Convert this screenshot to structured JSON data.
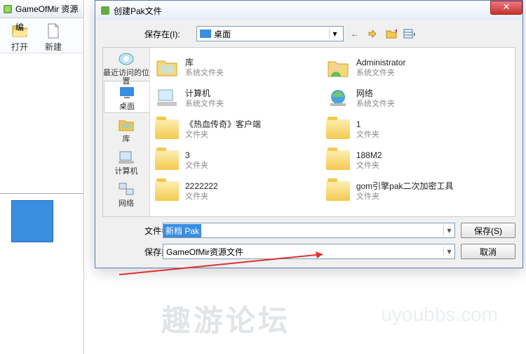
{
  "app": {
    "title": "GameOfMir 资源编"
  },
  "toolbar": {
    "open": "打开",
    "new": "新建"
  },
  "dialog": {
    "title": "创建Pak文件",
    "close": "✕",
    "save_in_label": "保存在(I):",
    "save_in_value": "桌面",
    "sidebar": [
      {
        "label": "最近访问的位置"
      },
      {
        "label": "桌面"
      },
      {
        "label": "库"
      },
      {
        "label": "计算机"
      },
      {
        "label": "网络"
      }
    ],
    "files": [
      [
        {
          "name": "库",
          "type": "系统文件夹"
        },
        {
          "name": "Administrator",
          "type": "系统文件夹"
        }
      ],
      [
        {
          "name": "计算机",
          "type": "系统文件夹"
        },
        {
          "name": "网络",
          "type": "系统文件夹"
        }
      ],
      [
        {
          "name": "《热血传奇》客户端",
          "type": "文件夹"
        },
        {
          "name": "1",
          "type": "文件夹"
        }
      ],
      [
        {
          "name": "3",
          "type": "文件夹"
        },
        {
          "name": "188M2",
          "type": "文件夹"
        }
      ],
      [
        {
          "name": "2222222",
          "type": "文件夹"
        },
        {
          "name": "gom引擎pak二次加密工具",
          "type": "文件夹"
        }
      ]
    ],
    "filename_label": "文件名(N):",
    "filename_value": "新档 Pak",
    "filetype_label": "保存类型(T):",
    "filetype_value": "GameOfMir资源文件",
    "save_btn": "保存(S)",
    "cancel_btn": "取消"
  },
  "watermark": "趣游论坛"
}
